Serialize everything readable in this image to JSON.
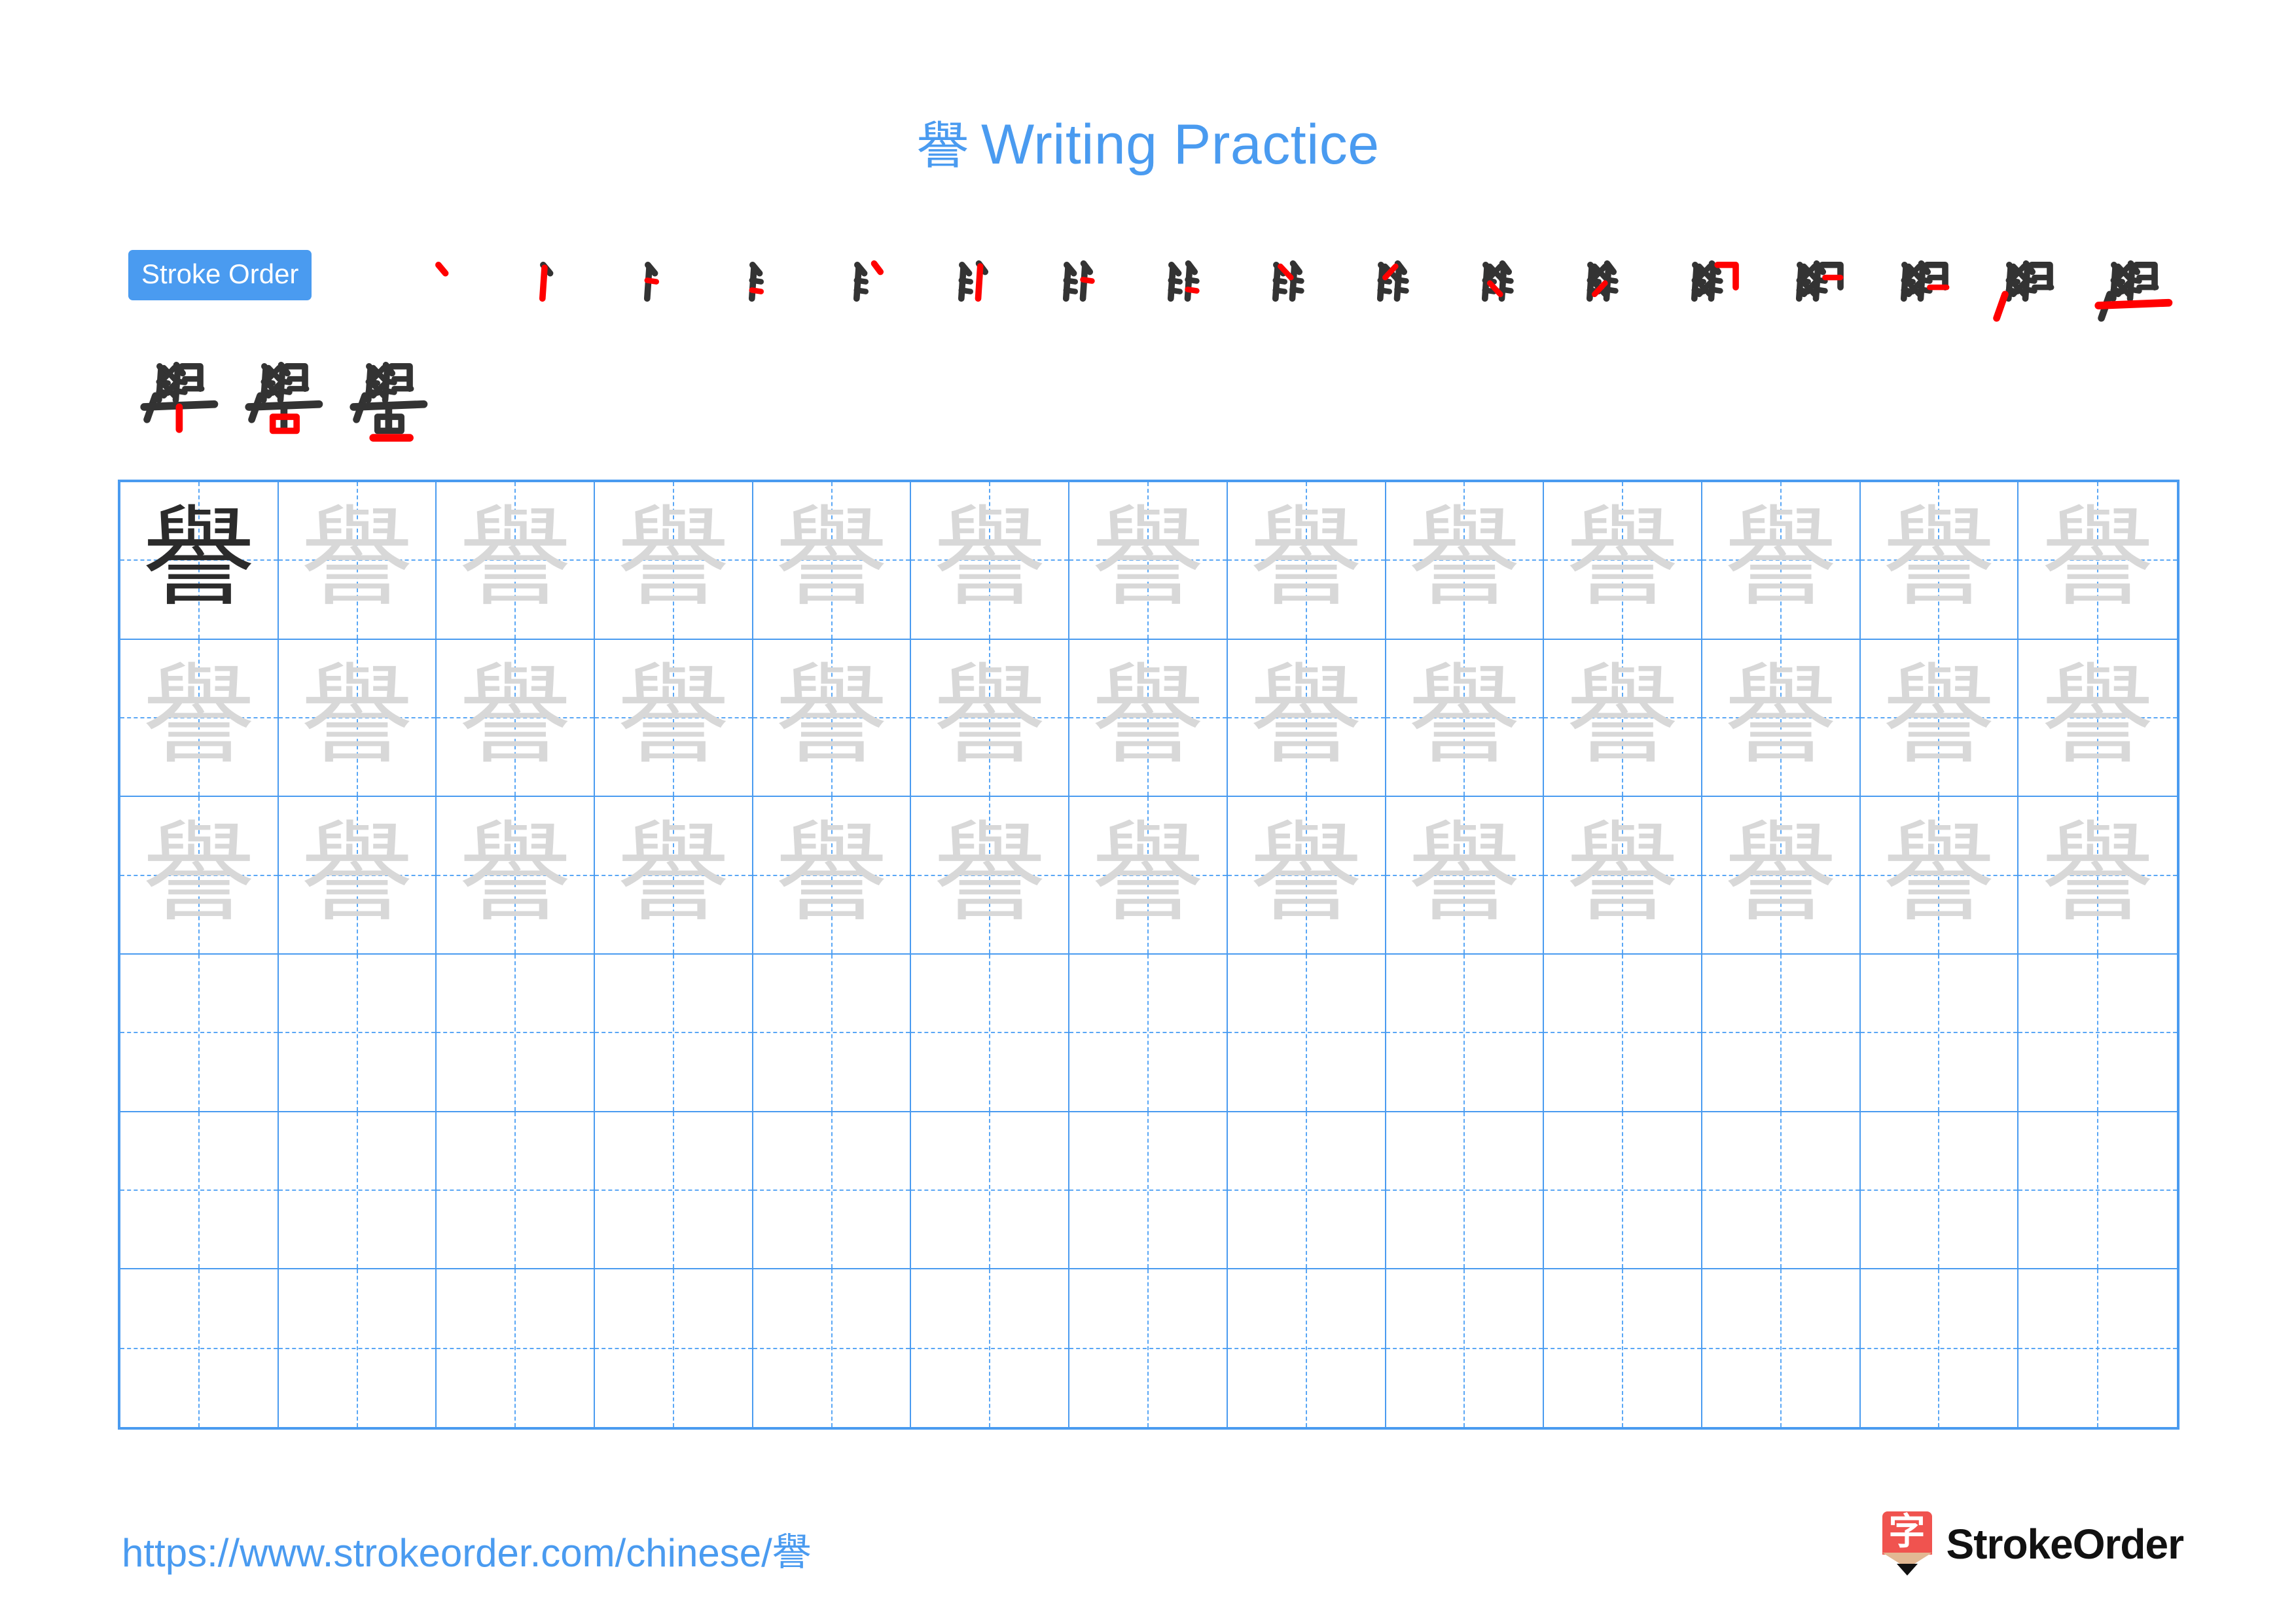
{
  "character": "譽",
  "title": {
    "character": "譽",
    "suffix": "Writing Practice",
    "color": "#4a9bf0"
  },
  "stroke_order": {
    "badge_label": "Stroke Order",
    "badge_bg": "#4a9bf0",
    "badge_text_color": "#ffffff",
    "total_strokes": 20,
    "base_stroke_color": "#333333",
    "new_stroke_color": "#ff0000",
    "rows": [
      {
        "steps": [
          1,
          2,
          3,
          4,
          5,
          6,
          7,
          8,
          9,
          10,
          11,
          12,
          13,
          14,
          15,
          16,
          17
        ]
      },
      {
        "steps": [
          18,
          19,
          20
        ]
      }
    ],
    "step_glyphs": [
      "丶",
      "亻",
      "乍",
      "乍",
      "𠂆",
      "𠂇",
      "彑",
      "彑",
      "段",
      "段",
      "段",
      "段",
      "舆",
      "與",
      "與",
      "學",
      "學",
      "學",
      "譽",
      "譽"
    ]
  },
  "practice_grid": {
    "columns": 13,
    "rows": 6,
    "grid_line_color": "#4a9bf0",
    "guide_line_color": "#5aa7f5",
    "model_glyph_color": "#2b2b2b",
    "trace_glyph_color": "#d8d8d8",
    "row_types": [
      "model-then-trace",
      "trace",
      "trace",
      "blank",
      "blank",
      "blank"
    ],
    "cells": [
      [
        "譽",
        "譽",
        "譽",
        "譽",
        "譽",
        "譽",
        "譽",
        "譽",
        "譽",
        "譽",
        "譽",
        "譽",
        "譽"
      ],
      [
        "譽",
        "譽",
        "譽",
        "譽",
        "譽",
        "譽",
        "譽",
        "譽",
        "譽",
        "譽",
        "譽",
        "譽",
        "譽"
      ],
      [
        "譽",
        "譽",
        "譽",
        "譽",
        "譽",
        "譽",
        "譽",
        "譽",
        "譽",
        "譽",
        "譽",
        "譽",
        "譽"
      ],
      [
        "",
        "",
        "",
        "",
        "",
        "",
        "",
        "",
        "",
        "",
        "",
        "",
        ""
      ],
      [
        "",
        "",
        "",
        "",
        "",
        "",
        "",
        "",
        "",
        "",
        "",
        "",
        ""
      ],
      [
        "",
        "",
        "",
        "",
        "",
        "",
        "",
        "",
        "",
        "",
        "",
        "",
        ""
      ]
    ]
  },
  "footer": {
    "url_prefix": "https://www.strokeorder.com/chinese/",
    "url_character": "譽",
    "url_color": "#4a9bf0",
    "brand_name": "StrokeOrder",
    "brand_mark_char": "字",
    "brand_mark_color": "#f0534f",
    "brand_text_color": "#111111"
  }
}
